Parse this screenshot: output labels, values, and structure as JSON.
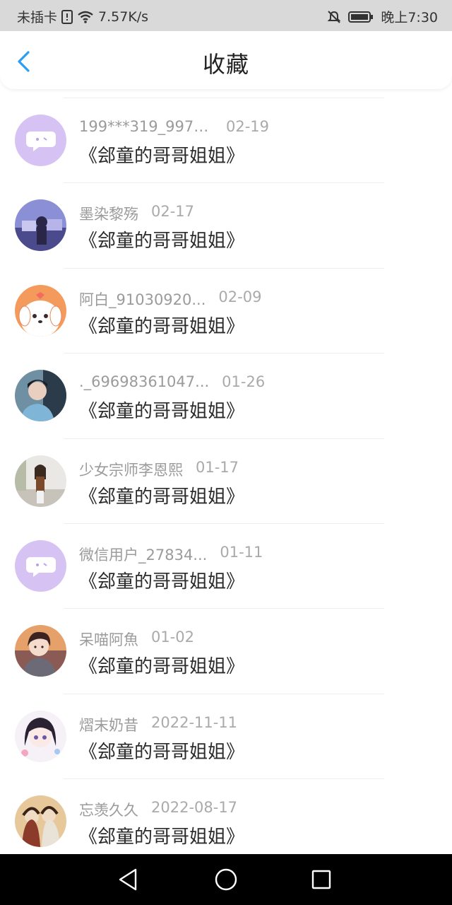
{
  "status_bar": {
    "carrier": "未插卡",
    "speed": "7.57K/s",
    "time": "晚上7:30",
    "icons": [
      "sim-alert-icon",
      "wifi-icon",
      "mute-bell-icon",
      "battery-icon"
    ]
  },
  "header": {
    "title": "收藏",
    "back_icon": "chevron-left-icon",
    "accent_color": "#2a9df4"
  },
  "favorites": [
    {
      "username": "199***319_9972...",
      "date": "02-19",
      "title": "《郐童的哥哥姐姐》",
      "avatar": "default-chat-avatar"
    },
    {
      "username": "墨染黎殇",
      "date": "02-17",
      "title": "《郐童的哥哥姐姐》",
      "avatar": "photo-avatar"
    },
    {
      "username": "阿白_91030920...",
      "date": "02-09",
      "title": "《郐童的哥哥姐姐》",
      "avatar": "cartoon-dog-avatar"
    },
    {
      "username": "._69698361047...",
      "date": "01-26",
      "title": "《郐童的哥哥姐姐》",
      "avatar": "photo-avatar"
    },
    {
      "username": "少女宗师李恩熙",
      "date": "01-17",
      "title": "《郐童的哥哥姐姐》",
      "avatar": "photo-avatar"
    },
    {
      "username": "微信用户_27834...",
      "date": "01-11",
      "title": "《郐童的哥哥姐姐》",
      "avatar": "default-chat-avatar"
    },
    {
      "username": "呆喵阿魚",
      "date": "01-02",
      "title": "《郐童的哥哥姐姐》",
      "avatar": "anime-avatar"
    },
    {
      "username": "熠末奶昔",
      "date": "2022-11-11",
      "title": "《郐童的哥哥姐姐》",
      "avatar": "anime-avatar"
    },
    {
      "username": "忘羡久久",
      "date": "2022-08-17",
      "title": "《郐童的哥哥姐姐》",
      "avatar": "illustration-avatar"
    }
  ],
  "system_nav": {
    "icons": [
      "back-triangle-icon",
      "home-circle-icon",
      "recents-square-icon"
    ]
  }
}
